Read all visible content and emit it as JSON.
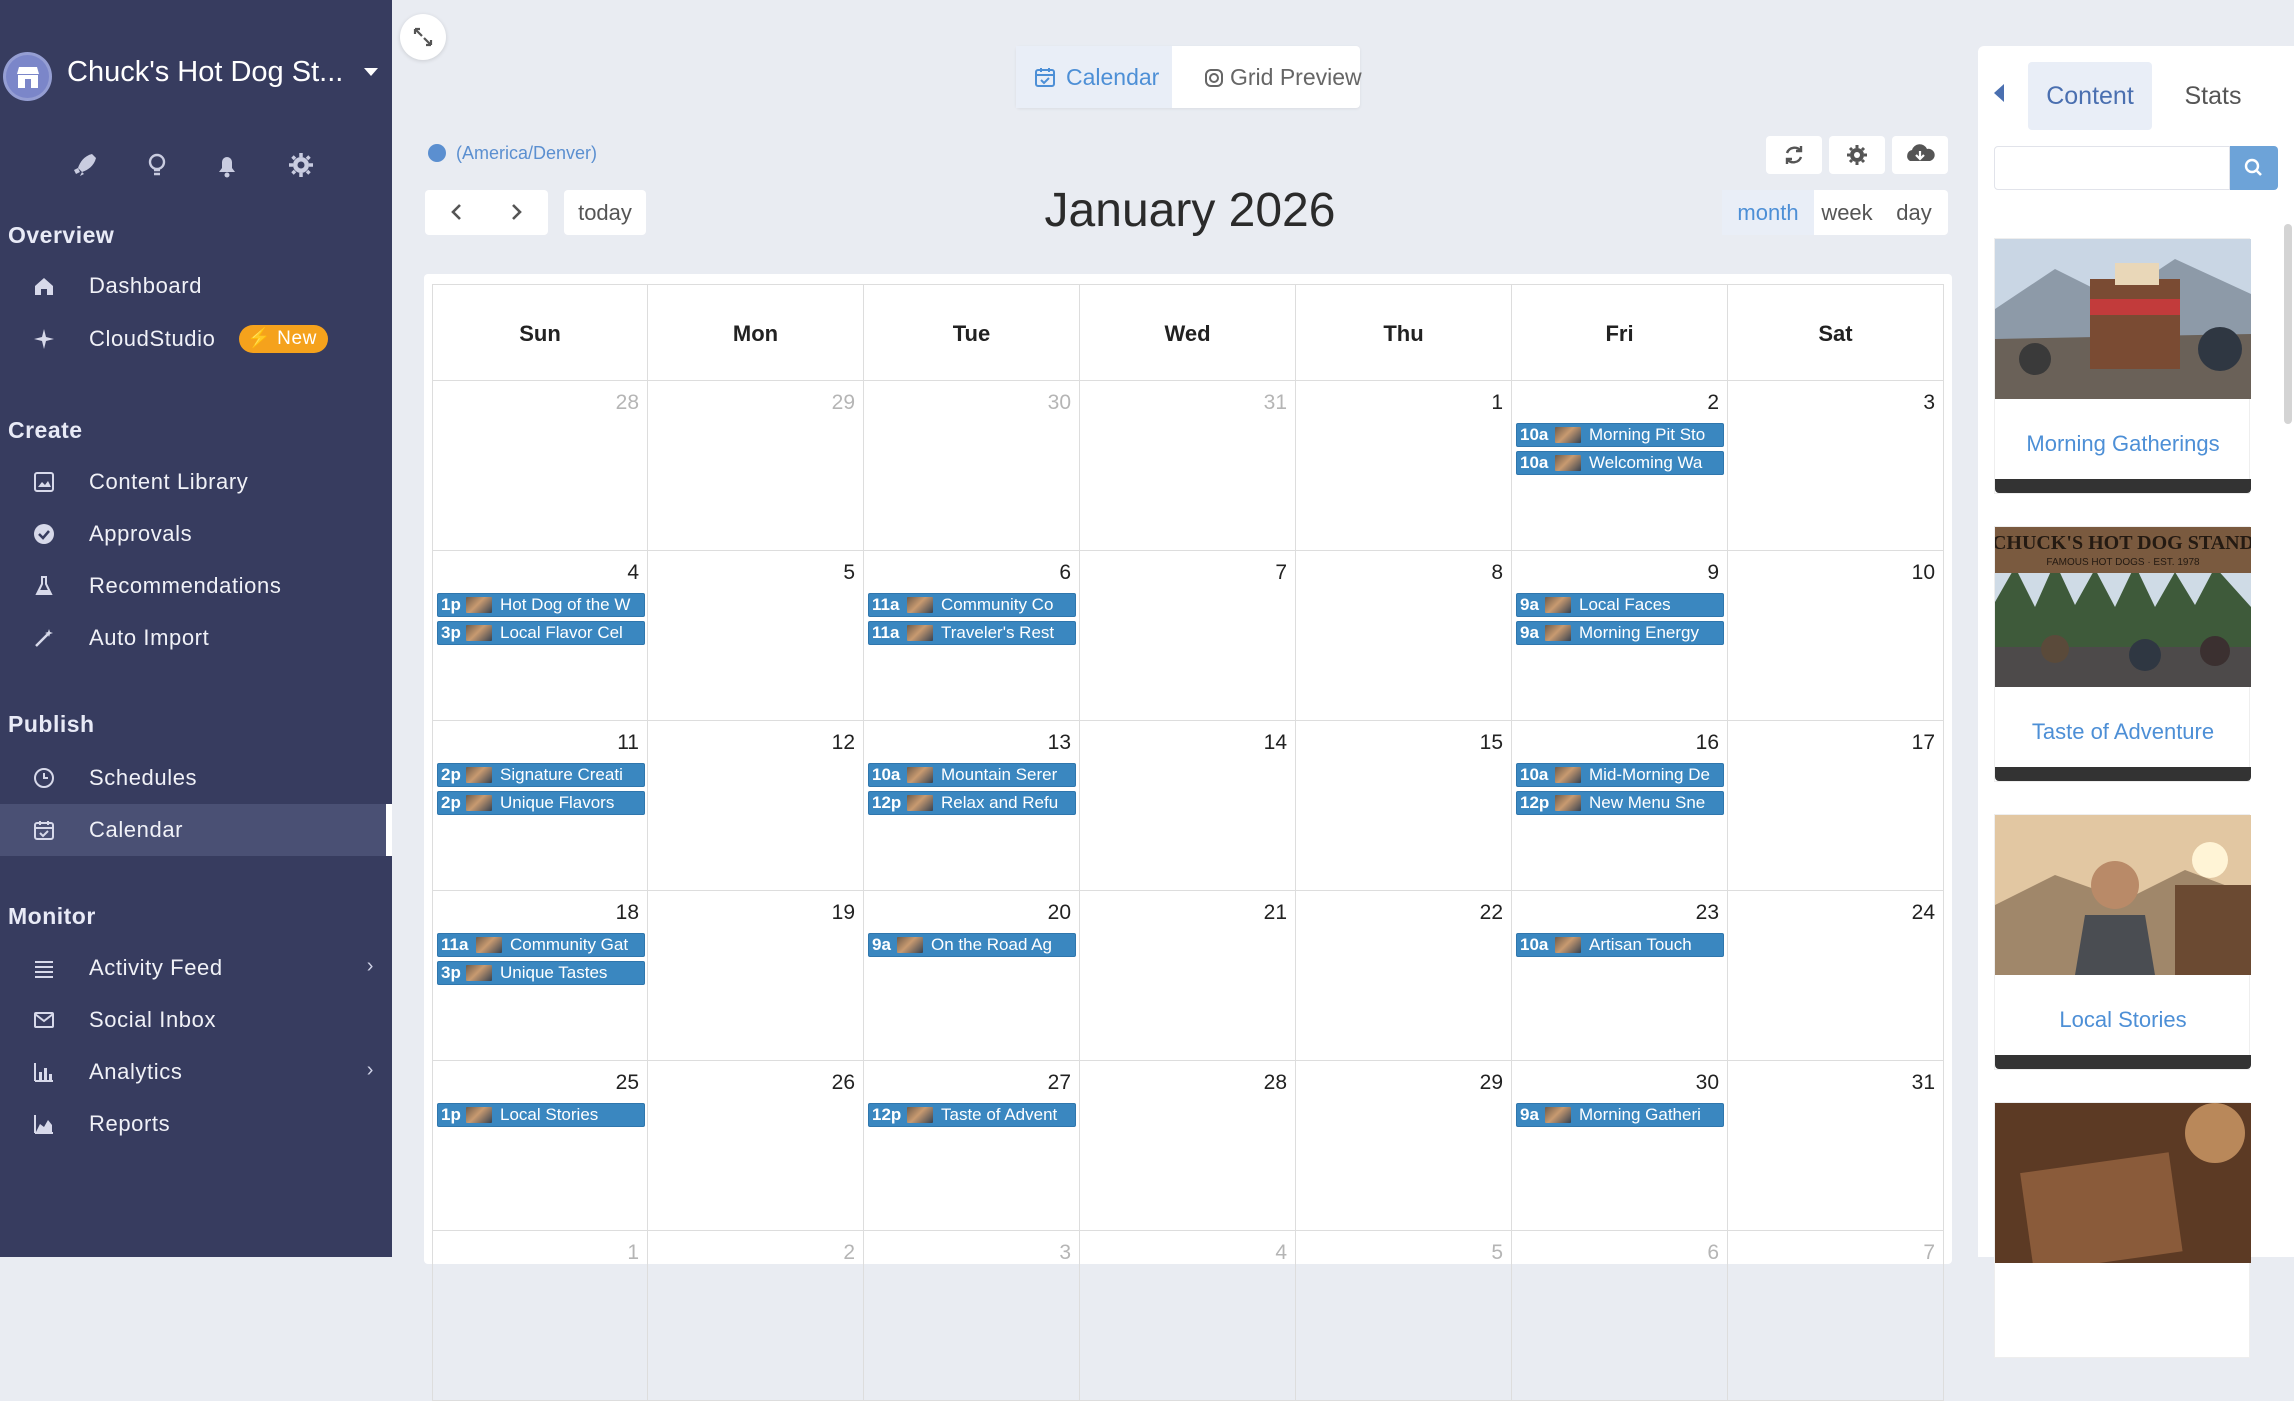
{
  "brand": {
    "name": "Chuck's Hot Dog St..."
  },
  "sidebar": {
    "top_icons": [
      "rocket-icon",
      "lightbulb-icon",
      "bell-icon",
      "gear-icon"
    ],
    "sections": [
      {
        "title": "Overview",
        "items": [
          {
            "label": "Dashboard",
            "icon": "home-icon"
          },
          {
            "label": "CloudStudio",
            "icon": "sparkle-icon",
            "badge": "New"
          }
        ]
      },
      {
        "title": "Create",
        "items": [
          {
            "label": "Content Library",
            "icon": "image-icon"
          },
          {
            "label": "Approvals",
            "icon": "check-circle-icon"
          },
          {
            "label": "Recommendations",
            "icon": "flask-icon"
          },
          {
            "label": "Auto Import",
            "icon": "wand-icon"
          }
        ]
      },
      {
        "title": "Publish",
        "items": [
          {
            "label": "Schedules",
            "icon": "clock-icon"
          },
          {
            "label": "Calendar",
            "icon": "calendar-check-icon",
            "active": true
          }
        ]
      },
      {
        "title": "Monitor",
        "items": [
          {
            "label": "Activity Feed",
            "icon": "list-icon",
            "chevron": true
          },
          {
            "label": "Social Inbox",
            "icon": "envelope-icon"
          },
          {
            "label": "Analytics",
            "icon": "bar-chart-icon",
            "chevron": true
          },
          {
            "label": "Reports",
            "icon": "area-chart-icon"
          }
        ]
      }
    ]
  },
  "view_toggle": {
    "calendar_label": "Calendar",
    "grid_label": "Grid Preview",
    "active": "calendar"
  },
  "timezone": "(America/Denver)",
  "toolbar": {
    "today_label": "today",
    "title": "January 2026",
    "views": [
      "month",
      "week",
      "day"
    ],
    "active_view": "month"
  },
  "calendar": {
    "weekdays": [
      "Sun",
      "Mon",
      "Tue",
      "Wed",
      "Thu",
      "Fri",
      "Sat"
    ],
    "weeks": [
      [
        {
          "d": "28",
          "m": true
        },
        {
          "d": "29",
          "m": true
        },
        {
          "d": "30",
          "m": true
        },
        {
          "d": "31",
          "m": true
        },
        {
          "d": "1"
        },
        {
          "d": "2",
          "events": [
            {
              "t": "10a",
              "title": "Morning Pit Sto"
            },
            {
              "t": "10a",
              "title": "Welcoming Wa"
            }
          ]
        },
        {
          "d": "3"
        }
      ],
      [
        {
          "d": "4",
          "events": [
            {
              "t": "1p",
              "title": "Hot Dog of the W"
            },
            {
              "t": "3p",
              "title": "Local Flavor Cel"
            }
          ]
        },
        {
          "d": "5"
        },
        {
          "d": "6",
          "events": [
            {
              "t": "11a",
              "title": "Community Co"
            },
            {
              "t": "11a",
              "title": "Traveler's Rest"
            }
          ]
        },
        {
          "d": "7"
        },
        {
          "d": "8"
        },
        {
          "d": "9",
          "events": [
            {
              "t": "9a",
              "title": "Local Faces"
            },
            {
              "t": "9a",
              "title": "Morning Energy"
            }
          ]
        },
        {
          "d": "10"
        }
      ],
      [
        {
          "d": "11",
          "events": [
            {
              "t": "2p",
              "title": "Signature Creati"
            },
            {
              "t": "2p",
              "title": "Unique Flavors"
            }
          ]
        },
        {
          "d": "12"
        },
        {
          "d": "13",
          "events": [
            {
              "t": "10a",
              "title": "Mountain Serer"
            },
            {
              "t": "12p",
              "title": "Relax and Refu"
            }
          ]
        },
        {
          "d": "14"
        },
        {
          "d": "15"
        },
        {
          "d": "16",
          "events": [
            {
              "t": "10a",
              "title": "Mid-Morning De"
            },
            {
              "t": "12p",
              "title": "New Menu Sne"
            }
          ]
        },
        {
          "d": "17"
        }
      ],
      [
        {
          "d": "18",
          "events": [
            {
              "t": "11a",
              "title": "Community Gat"
            },
            {
              "t": "3p",
              "title": "Unique Tastes"
            }
          ]
        },
        {
          "d": "19"
        },
        {
          "d": "20",
          "events": [
            {
              "t": "9a",
              "title": "On the Road Ag"
            }
          ]
        },
        {
          "d": "21"
        },
        {
          "d": "22"
        },
        {
          "d": "23",
          "events": [
            {
              "t": "10a",
              "title": "Artisan Touch"
            }
          ]
        },
        {
          "d": "24"
        }
      ],
      [
        {
          "d": "25",
          "events": [
            {
              "t": "1p",
              "title": "Local Stories"
            }
          ]
        },
        {
          "d": "26"
        },
        {
          "d": "27",
          "events": [
            {
              "t": "12p",
              "title": "Taste of Advent"
            }
          ]
        },
        {
          "d": "28"
        },
        {
          "d": "29"
        },
        {
          "d": "30",
          "events": [
            {
              "t": "9a",
              "title": "Morning Gatheri"
            }
          ]
        },
        {
          "d": "31"
        }
      ],
      [
        {
          "d": "1",
          "m": true
        },
        {
          "d": "2",
          "m": true
        },
        {
          "d": "3",
          "m": true
        },
        {
          "d": "4",
          "m": true
        },
        {
          "d": "5",
          "m": true
        },
        {
          "d": "6",
          "m": true
        },
        {
          "d": "7",
          "m": true
        }
      ]
    ]
  },
  "right_panel": {
    "tabs": [
      "Content",
      "Stats"
    ],
    "active_tab": "Content",
    "search_placeholder": "",
    "cards": [
      {
        "label": "Morning Gatherings"
      },
      {
        "label": "Taste of Adventure",
        "sign_text": "CHUCK'S HOT DOG STAND",
        "sign_subtext": "FAMOUS HOT DOGS · EST. 1978"
      },
      {
        "label": "Local Stories"
      },
      {
        "label": ""
      }
    ]
  },
  "colors": {
    "sidebar_bg": "#373c5f",
    "accent": "#4d8fd6",
    "event_bg": "#3a87c0",
    "badge_new": "#f5a21c"
  }
}
